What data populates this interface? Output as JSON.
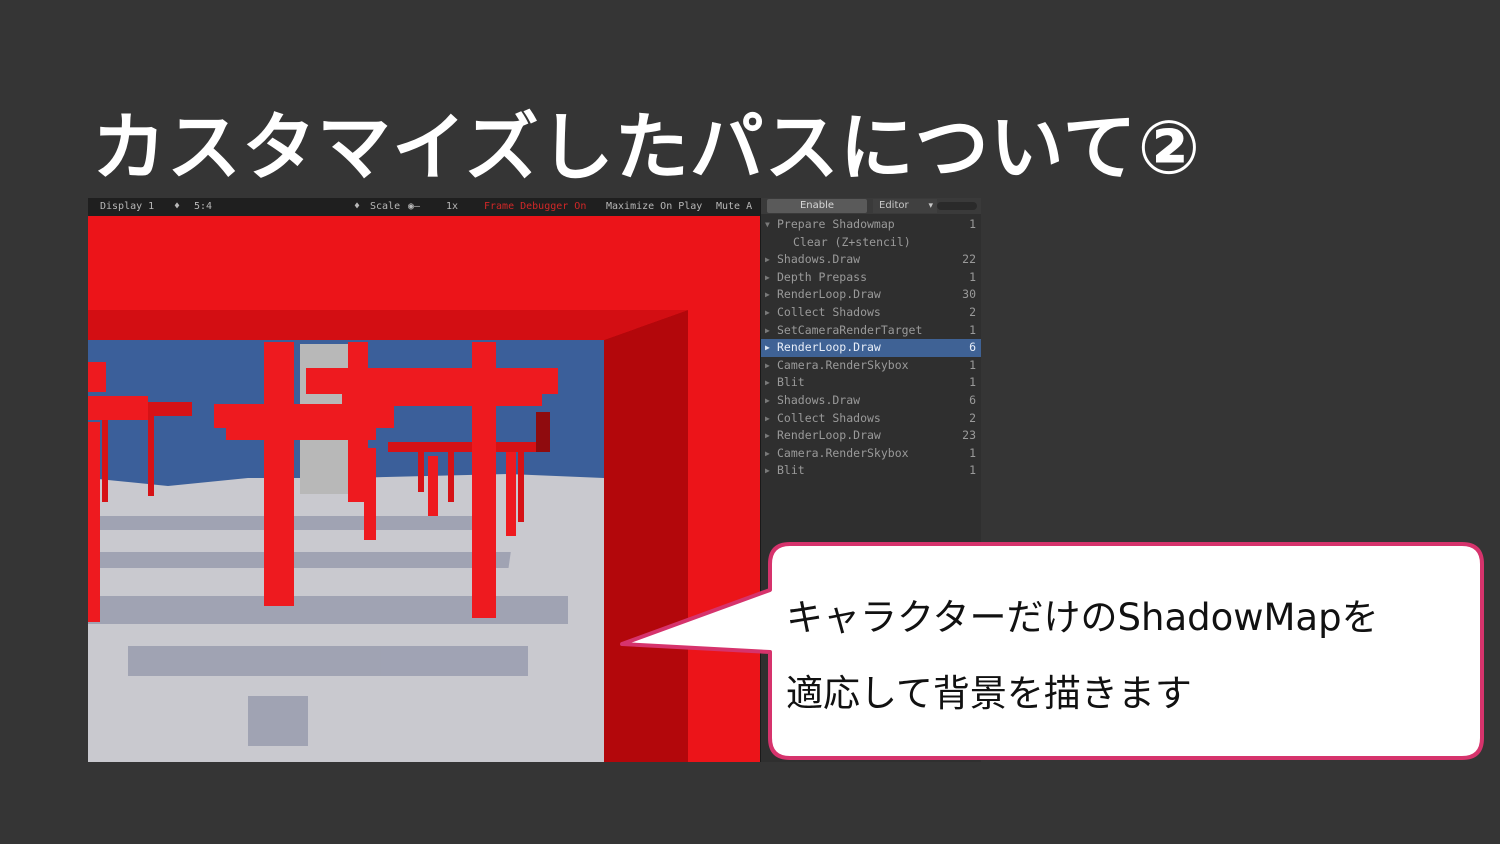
{
  "slide": {
    "title": "カスタマイズしたパスについて②"
  },
  "game_view": {
    "toolbar": {
      "display": "Display 1",
      "aspect": "5:4",
      "scale_label": "Scale",
      "scale_value": "1x",
      "frame_debugger": "Frame Debugger On",
      "maximize": "Maximize On Play",
      "mute": "Mute A"
    }
  },
  "frame_debugger": {
    "enable_label": "Enable",
    "target_label": "Editor",
    "events": [
      {
        "label": "Prepare Shadowmap",
        "count": "1",
        "expanded": true
      },
      {
        "label": "Clear (Z+stencil)",
        "count": "",
        "child": true
      },
      {
        "label": "Shadows.Draw",
        "count": "22"
      },
      {
        "label": "Depth Prepass",
        "count": "1"
      },
      {
        "label": "RenderLoop.Draw",
        "count": "30"
      },
      {
        "label": "Collect Shadows",
        "count": "2"
      },
      {
        "label": "SetCameraRenderTarget",
        "count": "1"
      },
      {
        "label": "RenderLoop.Draw",
        "count": "6",
        "selected": true
      },
      {
        "label": "Camera.RenderSkybox",
        "count": "1"
      },
      {
        "label": "Blit",
        "count": "1"
      },
      {
        "label": "Shadows.Draw",
        "count": "6"
      },
      {
        "label": "Collect Shadows",
        "count": "2"
      },
      {
        "label": "RenderLoop.Draw",
        "count": "23"
      },
      {
        "label": "Camera.RenderSkybox",
        "count": "1"
      },
      {
        "label": "Blit",
        "count": "1"
      }
    ]
  },
  "callout": {
    "line1": "キャラクターだけのShadowMapを",
    "line2": "適応して背景を描きます",
    "border_color": "#d6336c"
  },
  "colors": {
    "background": "#353535",
    "torii_red": "#e8141a",
    "sky": "#3b5f9a",
    "ground": "#c9c9cf",
    "selection": "#3f6295"
  }
}
